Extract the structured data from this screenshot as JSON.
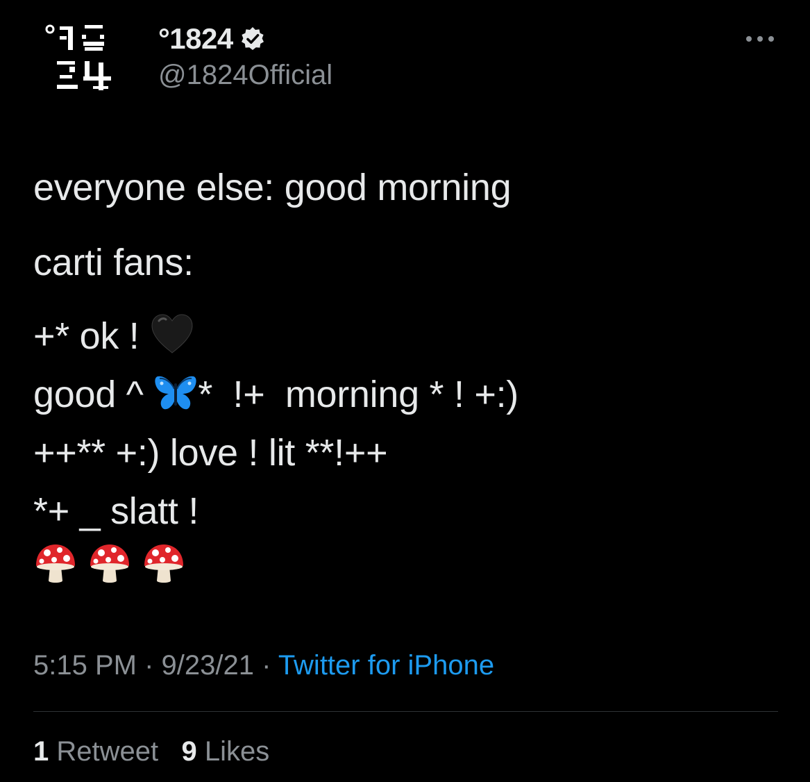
{
  "author": {
    "display_name": "°1824",
    "handle": "@1824Official",
    "verified": true,
    "avatar_text": [
      "°18",
      "24"
    ]
  },
  "tweet": {
    "line1": "everyone else: good morning",
    "line2": "carti fans:",
    "line3_text": "+* ok ! ",
    "line3_emoji": "black-heart",
    "line4_pre": "good ^ ",
    "line4_emoji": "butterfly",
    "line4_post": "*  !+  morning * ! +:)",
    "line5": "++** +:) love ! lit **!++",
    "line6": "*+ _ slatt !",
    "emoji_row": [
      "mushroom",
      "mushroom",
      "mushroom"
    ]
  },
  "meta": {
    "time": "5:15 PM",
    "separator": " · ",
    "date": "9/23/21",
    "source": "Twitter for iPhone"
  },
  "stats": {
    "retweets_count": "1",
    "retweets_label": "Retweet",
    "likes_count": "9",
    "likes_label": "Likes"
  },
  "colors": {
    "background": "#000000",
    "text": "#e7e9ea",
    "secondary": "#8b9095",
    "link": "#1d9bf0",
    "divider": "#2f3336"
  }
}
